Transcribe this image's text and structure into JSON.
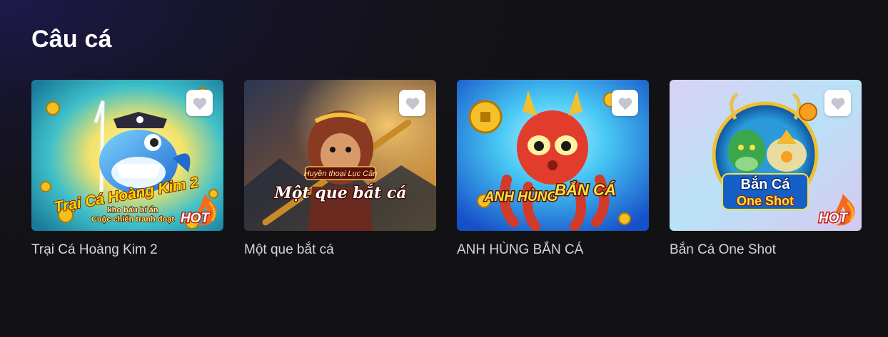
{
  "section": {
    "title": "Câu cá"
  },
  "games": [
    {
      "name": "Trại Cá Hoàng Kim 2",
      "art_title": "Trại Cá Hoàng Kim 2",
      "art_subtitle_1": "kho báu bí ẩn",
      "art_subtitle_2": "Cuộc chiến tranh đoạt",
      "hot": true,
      "hot_label": "HOT",
      "favorite_icon": "heart-icon"
    },
    {
      "name": "Một que bắt cá",
      "art_tagline": "Huyền thoại Lục Căn",
      "art_title": "Một que bắt cá",
      "hot": false,
      "favorite_icon": "heart-icon"
    },
    {
      "name": "ANH HÙNG BẮN CÁ",
      "art_title_left": "ANH HÙNG",
      "art_title_right": "BẮN CÁ",
      "hot": false,
      "favorite_icon": "heart-icon"
    },
    {
      "name": "Bắn Cá One Shot",
      "art_title_1": "Bắn Cá",
      "art_title_2": "One Shot",
      "hot": true,
      "hot_label": "HOT",
      "favorite_icon": "heart-icon"
    }
  ],
  "colors": {
    "card_label": "#d6d6da",
    "fav_button_bg": "#ffffff",
    "heart_icon": "#c3c6d1",
    "hot_badge": "#e8431a"
  }
}
